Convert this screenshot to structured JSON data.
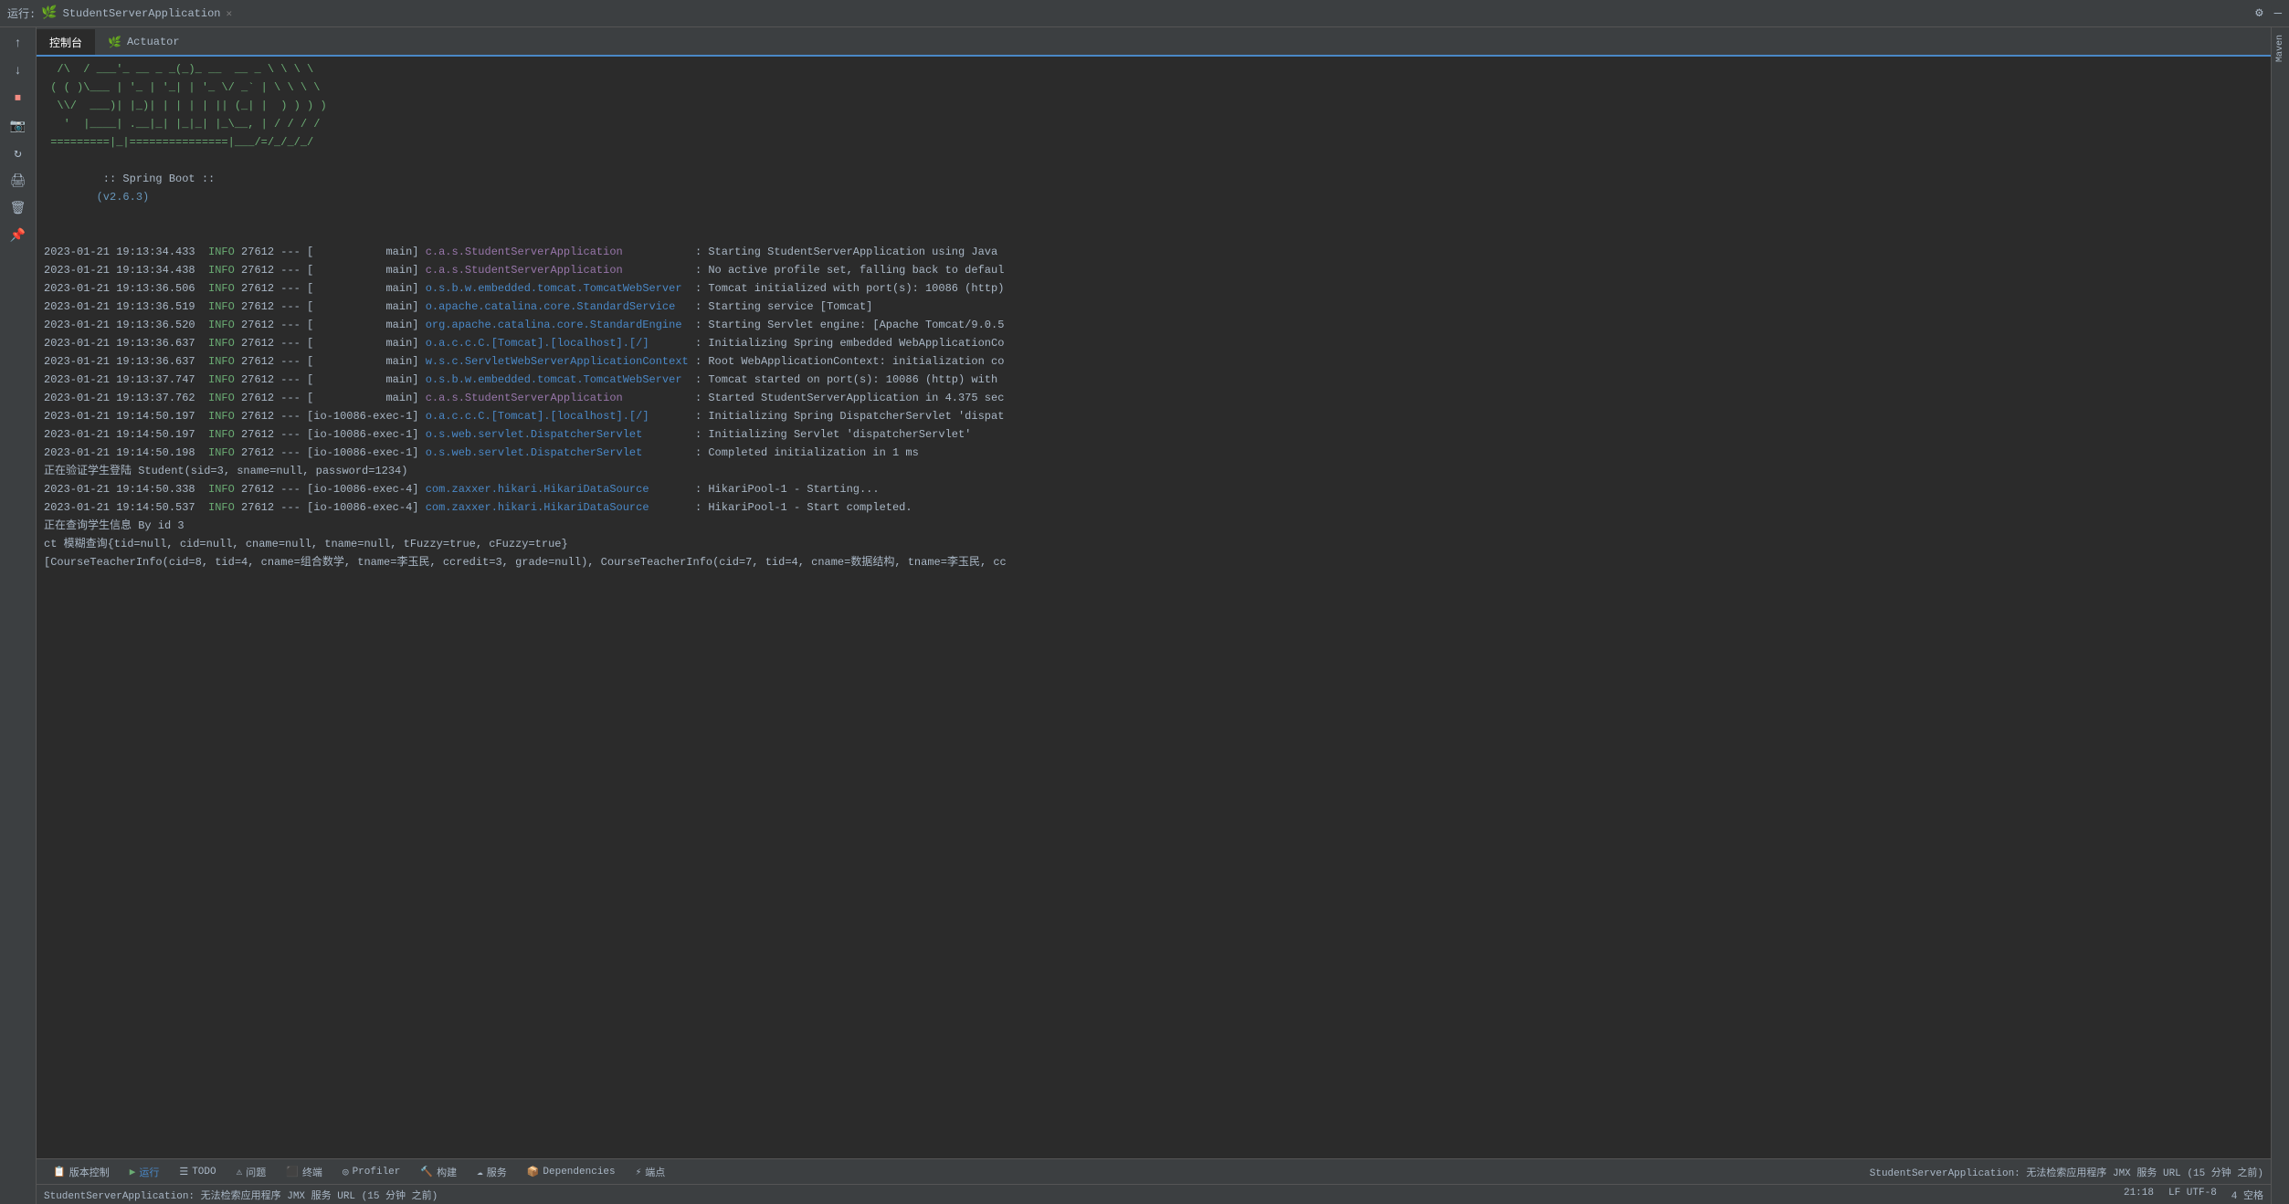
{
  "topbar": {
    "status": "运行:",
    "app_name": "StudentServerApplication",
    "settings_icon": "⚙",
    "minimize_icon": "—"
  },
  "tabs": [
    {
      "label": "控制台",
      "active": true
    },
    {
      "label": "Actuator",
      "active": false
    }
  ],
  "sidebar_icons": [
    "↑",
    "↓",
    "⏹",
    "📷",
    "↻",
    "🖨",
    "🗑",
    "📌"
  ],
  "console": {
    "ascii_art": [
      "  /\\\\  / ___'_ __ _ _(_)_ __  __ _ \\ \\ \\ \\",
      " ( ( )\\___ | '_ | '_| | '_ \\/ _` | \\ \\ \\ \\",
      "  \\\\/  ___)| |_)| | | | | || (_| |  ) ) ) )",
      "   '  |____| .__|_| |_|_| |_\\__, | / / / /",
      " =========|_|===============|___/=/_/_/_/"
    ],
    "spring_boot_label": ":: Spring Boot ::",
    "spring_boot_version": "(v2.6.3)",
    "log_entries": [
      {
        "timestamp": "2023-01-21 19:13:34.433",
        "level": "INFO",
        "pid": "27612",
        "separator": "---",
        "thread": "[           main]",
        "class": "c.a.s.StudentServerApplication",
        "class_color": "student",
        "message": ": Starting StudentServerApplication using Java"
      },
      {
        "timestamp": "2023-01-21 19:13:34.438",
        "level": "INFO",
        "pid": "27612",
        "separator": "---",
        "thread": "[           main]",
        "class": "c.a.s.StudentServerApplication",
        "class_color": "student",
        "message": ": No active profile set, falling back to defaul"
      },
      {
        "timestamp": "2023-01-21 19:13:36.506",
        "level": "INFO",
        "pid": "27612",
        "separator": "---",
        "thread": "[           main]",
        "class": "o.s.b.w.embedded.tomcat.TomcatWebServer",
        "class_color": "blue",
        "message": ": Tomcat initialized with port(s): 10086 (http)"
      },
      {
        "timestamp": "2023-01-21 19:13:36.519",
        "level": "INFO",
        "pid": "27612",
        "separator": "---",
        "thread": "[           main]",
        "class": "o.apache.catalina.core.StandardService",
        "class_color": "blue",
        "message": ": Starting service [Tomcat]"
      },
      {
        "timestamp": "2023-01-21 19:13:36.520",
        "level": "INFO",
        "pid": "27612",
        "separator": "---",
        "thread": "[           main]",
        "class": "org.apache.catalina.core.StandardEngine",
        "class_color": "blue",
        "message": ": Starting Servlet engine: [Apache Tomcat/9.0.5"
      },
      {
        "timestamp": "2023-01-21 19:13:36.637",
        "level": "INFO",
        "pid": "27612",
        "separator": "---",
        "thread": "[           main]",
        "class": "o.a.c.c.C.[Tomcat].[localhost].[/]",
        "class_color": "blue",
        "message": ": Initializing Spring embedded WebApplicationCo"
      },
      {
        "timestamp": "2023-01-21 19:13:36.637",
        "level": "INFO",
        "pid": "27612",
        "separator": "---",
        "thread": "[           main]",
        "class": "w.s.c.ServletWebServerApplicationContext",
        "class_color": "blue",
        "message": ": Root WebApplicationContext: initialization co"
      },
      {
        "timestamp": "2023-01-21 19:13:37.747",
        "level": "INFO",
        "pid": "27612",
        "separator": "---",
        "thread": "[           main]",
        "class": "o.s.b.w.embedded.tomcat.TomcatWebServer",
        "class_color": "blue",
        "message": ": Tomcat started on port(s): 10086 (http) with"
      },
      {
        "timestamp": "2023-01-21 19:13:37.762",
        "level": "INFO",
        "pid": "27612",
        "separator": "---",
        "thread": "[           main]",
        "class": "c.a.s.StudentServerApplication",
        "class_color": "student",
        "message": ": Started StudentServerApplication in 4.375 sec"
      },
      {
        "timestamp": "2023-01-21 19:14:50.197",
        "level": "INFO",
        "pid": "27612",
        "separator": "---",
        "thread": "[io-10086-exec-1]",
        "class": "o.a.c.c.C.[Tomcat].[localhost].[/]",
        "class_color": "blue",
        "message": ": Initializing Spring DispatcherServlet 'dispat"
      },
      {
        "timestamp": "2023-01-21 19:14:50.197",
        "level": "INFO",
        "pid": "27612",
        "separator": "---",
        "thread": "[io-10086-exec-1]",
        "class": "o.s.web.servlet.DispatcherServlet",
        "class_color": "blue",
        "message": ": Initializing Servlet 'dispatcherServlet'"
      },
      {
        "timestamp": "2023-01-21 19:14:50.198",
        "level": "INFO",
        "pid": "27612",
        "separator": "---",
        "thread": "[io-10086-exec-1]",
        "class": "o.s.web.servlet.DispatcherServlet",
        "class_color": "blue",
        "message": ": Completed initialization in 1 ms"
      }
    ],
    "validation_line": "正在验证学生登陆 Student(sid=3, sname=null, password=1234)",
    "hikari_entries": [
      {
        "timestamp": "2023-01-21 19:14:50.338",
        "level": "INFO",
        "pid": "27612",
        "separator": "---",
        "thread": "[io-10086-exec-4]",
        "class": "com.zaxxer.hikari.HikariDataSource",
        "class_color": "blue",
        "message": ": HikariPool-1 - Starting..."
      },
      {
        "timestamp": "2023-01-21 19:14:50.537",
        "level": "INFO",
        "pid": "27612",
        "separator": "---",
        "thread": "[io-10086-exec-4]",
        "class": "com.zaxxer.hikari.HikariDataSource",
        "class_color": "blue",
        "message": ": HikariPool-1 - Start completed."
      }
    ],
    "query_line": "正在查询学生信息 By id 3",
    "ct_line": "ct 模糊查询{tid=null, cid=null, cname=null, tname=null, tFuzzy=true, cFuzzy=true}",
    "course_line": "[CourseTeacherInfo(cid=8, tid=4, cname=组合数学, tname=李玉民, ccredit=3, grade=null), CourseTeacherInfo(cid=7, tid=4, cname=数据结构, tname=李玉民, cc"
  },
  "bottom_tabs": [
    {
      "label": "版本控制",
      "icon": "📋",
      "active": false
    },
    {
      "label": "运行",
      "icon": "▶",
      "active": true
    },
    {
      "label": "TODO",
      "icon": "☰",
      "active": false
    },
    {
      "label": "问题",
      "icon": "⚠",
      "active": false
    },
    {
      "label": "终端",
      "icon": "⬛",
      "active": false
    },
    {
      "label": "Profiler",
      "icon": "◎",
      "active": false
    },
    {
      "label": "构建",
      "icon": "🔨",
      "active": false
    },
    {
      "label": "服务",
      "icon": "☁",
      "active": false
    },
    {
      "label": "Dependencies",
      "icon": "📦",
      "active": false
    },
    {
      "label": "端点",
      "icon": "⚡",
      "active": false
    }
  ],
  "status_bar": {
    "message": "StudentServerApplication: 无法检索应用程序 JMX 服务 URL (15 分钟 之前)",
    "time": "21:18",
    "encoding": "LF  UTF-8",
    "indent": "4 空格"
  },
  "right_sidebar": {
    "label": "Maven"
  }
}
